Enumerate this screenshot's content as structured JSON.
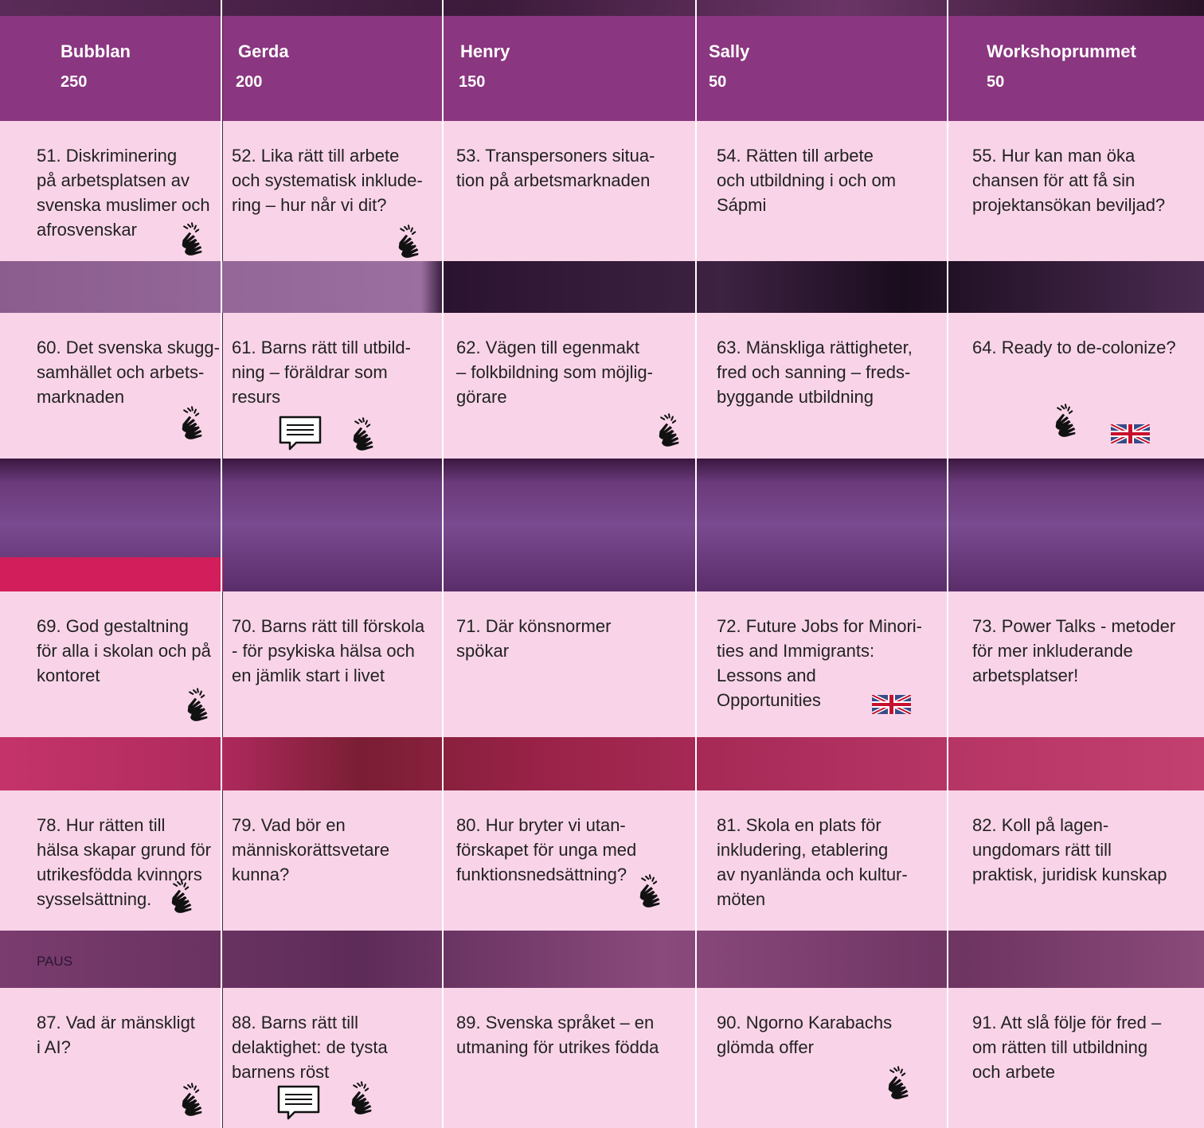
{
  "rooms": [
    {
      "name": "Bubblan",
      "capacity": "250"
    },
    {
      "name": "Gerda",
      "capacity": "200"
    },
    {
      "name": "Henry",
      "capacity": "150"
    },
    {
      "name": "Sally",
      "capacity": "50"
    },
    {
      "name": "Workshoprummet",
      "capacity": "50"
    }
  ],
  "rows": [
    [
      {
        "text": "51. Diskriminering\npå arbetsplatsen av\nsvenska muslimer och\nafrosvenskar",
        "sign_language": true
      },
      {
        "text": "52. Lika rätt till arbete\noch systematisk inklude-\nring – hur når vi dit?",
        "sign_language": true
      },
      {
        "text": "53. Transpersoners situa-\ntion på arbetsmarknaden"
      },
      {
        "text": "54. Rätten till arbete\noch utbildning i och om\nSápmi"
      },
      {
        "text": "55. Hur kan man öka\nchansen för att få sin\nprojektansökan beviljad?"
      }
    ],
    [
      {
        "text": "60. Det svenska skugg-\nsamhället och arbets-\nmarknaden",
        "sign_language": true
      },
      {
        "text": "61. Barns rätt till utbild-\nning – föräldrar som\nresurs",
        "sign_language": true,
        "captioning": true
      },
      {
        "text": "62. Vägen till egenmakt\n– folkbildning som möjlig-\ngörare",
        "sign_language": true
      },
      {
        "text": "63. Mänskliga rättigheter,\nfred och sanning – freds-\nbyggande utbildning"
      },
      {
        "text": "64. Ready to de-colonize?",
        "sign_language": true,
        "english": true
      }
    ],
    [
      {
        "text": "69. God gestaltning\nför alla i skolan och på\nkontoret",
        "sign_language": true
      },
      {
        "text": "70. Barns rätt till förskola\n- för psykiska hälsa och\nen jämlik start i livet"
      },
      {
        "text": "71. Där könsnormer\nspökar"
      },
      {
        "text": "72. Future Jobs for Minori-\nties and Immigrants:\nLessons and\nOpportunities",
        "english": true
      },
      {
        "text": "73. Power Talks - metoder\nför mer inkluderande\narbetsplatser!"
      }
    ],
    [
      {
        "text": "78. Hur rätten till\nhälsa skapar grund för\nutrikesfödda kvinnors\nsysselsättning.",
        "sign_language": true
      },
      {
        "text": "79. Vad bör en\nmänniskorättsvetare\nkunna?"
      },
      {
        "text": "80. Hur bryter vi utan-\nförskapet för unga med\nfunktionsnedsättning?",
        "sign_language": true
      },
      {
        "text": "81. Skola en plats för\ninkludering, etablering\nav nyanlända och kultur-\nmöten"
      },
      {
        "text": "82. Koll på lagen-\nungdomars rätt till\npraktisk, juridisk kunskap"
      }
    ],
    [
      {
        "text": "87. Vad är mänskligt\ni AI?",
        "sign_language": true
      },
      {
        "text": "88. Barns rätt till\ndelaktighet: de tysta\nbarnens röst",
        "sign_language": true,
        "captioning": true
      },
      {
        "text": "89. Svenska språket – en\nutmaning för utrikes födda"
      },
      {
        "text": "90. Ngorno Karabachs\nglömda offer",
        "sign_language": true
      },
      {
        "text": "91. Att slå följe för fred –\nom rätten till utbildning\noch arbete"
      }
    ]
  ],
  "pause_label": "PAUS",
  "icons": {
    "sign_language": "sign-language-icon",
    "captioning": "captioning-icon",
    "english": "uk-flag-icon"
  },
  "colors": {
    "header": "#8a3680",
    "cell": "#f9d4e8",
    "text": "#222222"
  }
}
